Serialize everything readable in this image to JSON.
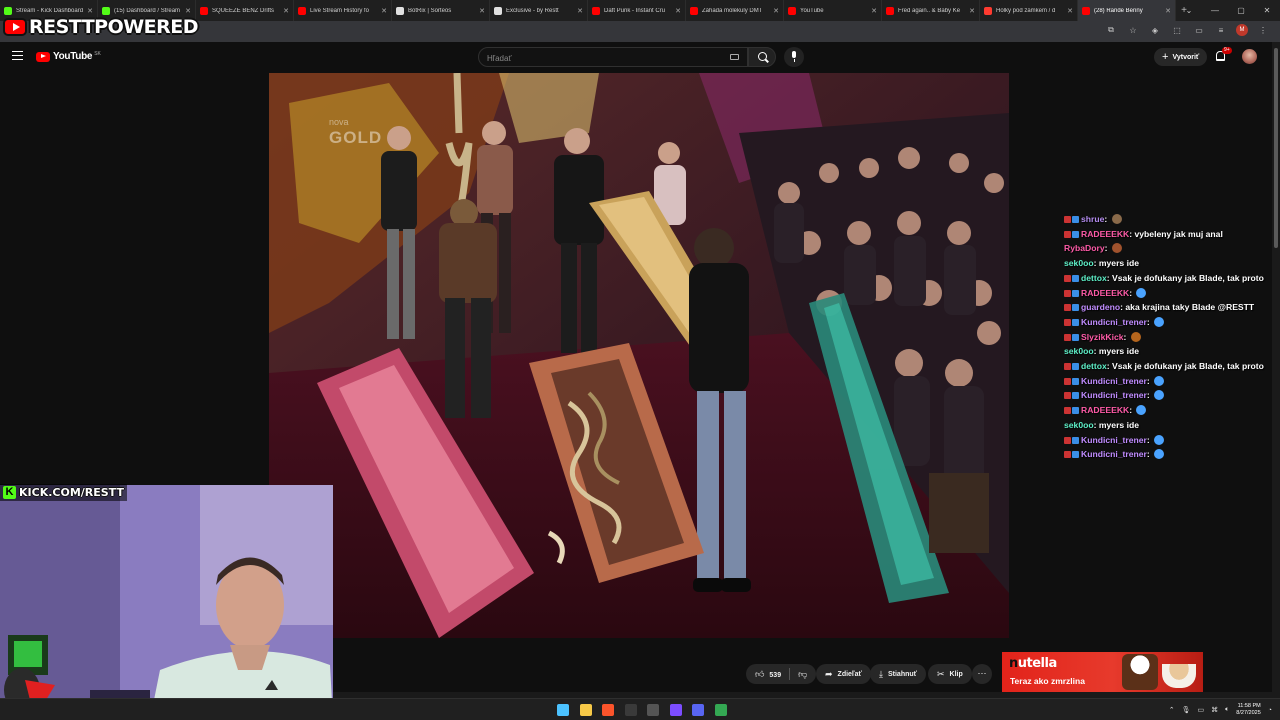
{
  "browser": {
    "tabs": [
      {
        "label": "Stream - Kick Dashboard",
        "favicon_color": "#53fc18",
        "active": false
      },
      {
        "label": "(15) Dashboard / Stream",
        "favicon_color": "#53fc18",
        "active": false
      },
      {
        "label": "SQUEEZE BENZ Drifts",
        "favicon_color": "#ff0000",
        "active": false
      },
      {
        "label": "Live Stream History fo",
        "favicon_color": "#ff0000",
        "active": false
      },
      {
        "label": "BotRix | Sorteos",
        "favicon_color": "#e0e0e0",
        "active": false
      },
      {
        "label": "Exclusive - by Restt",
        "favicon_color": "#e0e0e0",
        "active": false
      },
      {
        "label": "Daft Punk - Instant Cru",
        "favicon_color": "#ff0000",
        "active": false
      },
      {
        "label": "Záhada molekuly DMT",
        "favicon_color": "#ff0000",
        "active": false
      },
      {
        "label": "YouTube",
        "favicon_color": "#ff0000",
        "active": false
      },
      {
        "label": "Fred again.. & Baby Ke",
        "favicon_color": "#ff0000",
        "active": false
      },
      {
        "label": "Holky pod zámkem / d",
        "favicon_color": "#ff3b30",
        "active": false
      },
      {
        "label": "(28) Rande Benny",
        "favicon_color": "#ff0000",
        "active": true
      }
    ],
    "new_tab_symbol": "+",
    "url_fragment": "aSV02E",
    "profile_initial": "M"
  },
  "overlay": {
    "logo_text": "RESTTPOWERED",
    "kick_text": "KICK.COM/RESTT",
    "kick_letter": "K"
  },
  "youtube": {
    "logo_word": "YouTube",
    "logo_country": "SK",
    "search_placeholder": "Hľadať",
    "create_label": "Vytvoriť",
    "notifications_badge": "9+",
    "video_watermark_line1": "nova",
    "video_watermark_line2": "GOLD"
  },
  "actions": {
    "like_count": "539",
    "share_label": "Zdieľať",
    "download_label": "Stiahnuť",
    "clip_label": "Klip",
    "more_symbol": "···"
  },
  "ad": {
    "brand": "nutella",
    "tagline": "Teraz ako zmrzlina",
    "accent": "#e2231a"
  },
  "chat": {
    "messages": [
      {
        "user": "shrue",
        "color": "#b48cf0",
        "badges": true,
        "text": "",
        "emote": "#8a6a4a"
      },
      {
        "user": "RADEEEKK",
        "color": "#ff5ba8",
        "badges": true,
        "text": "vybeleny jak muj anal",
        "emote": ""
      },
      {
        "user": "RybaDory",
        "color": "#ff5ba8",
        "badges": false,
        "text": "",
        "emote": "#a0522d"
      },
      {
        "user": "sek0oo",
        "color": "#5ef0c8",
        "badges": false,
        "text": "myers ide",
        "emote": ""
      },
      {
        "user": "dettox",
        "color": "#5ef0c8",
        "badges": true,
        "text": "Vsak je dofukany jak Blade, tak proto",
        "emote": ""
      },
      {
        "user": "RADEEEKK",
        "color": "#ff5ba8",
        "badges": true,
        "text": "",
        "emote": "#4aa3ff"
      },
      {
        "user": "guardeno",
        "color": "#c08cff",
        "badges": true,
        "text": "aka krajina taky Blade @RESTT",
        "emote": ""
      },
      {
        "user": "Kundicni_trener",
        "color": "#c08cff",
        "badges": true,
        "text": "",
        "emote": "#4aa3ff"
      },
      {
        "user": "SlyzikKick",
        "color": "#ff5ba8",
        "badges": true,
        "text": "",
        "emote": "#b5651d"
      },
      {
        "user": "sek0oo",
        "color": "#5ef0c8",
        "badges": false,
        "text": "myers ide",
        "emote": ""
      },
      {
        "user": "dettox",
        "color": "#5ef0c8",
        "badges": true,
        "text": "Vsak je dofukany jak Blade, tak proto",
        "emote": ""
      },
      {
        "user": "Kundicni_trener",
        "color": "#c08cff",
        "badges": true,
        "text": "",
        "emote": "#4aa3ff"
      },
      {
        "user": "Kundicni_trener",
        "color": "#c08cff",
        "badges": true,
        "text": "",
        "emote": "#4aa3ff"
      },
      {
        "user": "RADEEEKK",
        "color": "#ff5ba8",
        "badges": true,
        "text": "",
        "emote": "#4aa3ff"
      },
      {
        "user": "sek0oo",
        "color": "#5ef0c8",
        "badges": false,
        "text": "myers ide",
        "emote": ""
      },
      {
        "user": "Kundicni_trener",
        "color": "#c08cff",
        "badges": true,
        "text": "",
        "emote": "#4aa3ff"
      },
      {
        "user": "Kundicni_trener",
        "color": "#c08cff",
        "badges": true,
        "text": "",
        "emote": "#4aa3ff"
      }
    ]
  },
  "taskbar": {
    "apps": [
      {
        "name": "windows-start",
        "color": "#4cc2ff"
      },
      {
        "name": "file-explorer",
        "color": "#f7c948"
      },
      {
        "name": "brave-browser",
        "color": "#fb542b"
      },
      {
        "name": "terminal",
        "color": "#3a3a3a"
      },
      {
        "name": "obs-studio",
        "color": "#555555"
      },
      {
        "name": "app-purple",
        "color": "#7c4dff"
      },
      {
        "name": "discord",
        "color": "#5865f2"
      },
      {
        "name": "chrome",
        "color": "#34a853"
      }
    ],
    "time": "11:58 PM",
    "date": "8/27/2025"
  }
}
